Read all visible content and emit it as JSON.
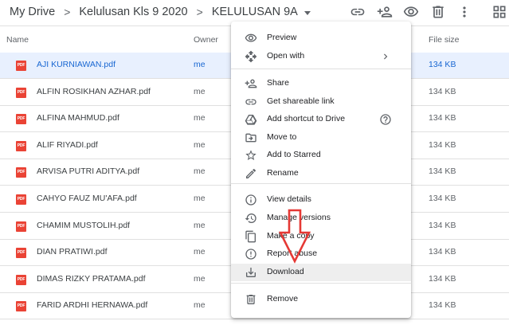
{
  "breadcrumb": {
    "items": [
      "My Drive",
      "Kelulusan Kls 9 2020",
      "KELULUSAN 9A"
    ],
    "separator": ">"
  },
  "toolbar": {
    "icons": [
      "link-icon",
      "add-person-icon",
      "eye-icon",
      "trash-icon",
      "more-vert-icon",
      "grid-view-icon"
    ]
  },
  "columns": {
    "name": "Name",
    "owner": "Owner",
    "file_size": "File size"
  },
  "files": [
    {
      "name": "AJI KURNIAWAN.pdf",
      "owner": "me",
      "size": "134 KB",
      "selected": true
    },
    {
      "name": "ALFIN ROSIKHAN AZHAR.pdf",
      "owner": "me",
      "size": "134 KB",
      "selected": false
    },
    {
      "name": "ALFINA MAHMUD.pdf",
      "owner": "me",
      "size": "134 KB",
      "selected": false
    },
    {
      "name": "ALIF RIYADI.pdf",
      "owner": "me",
      "size": "134 KB",
      "selected": false
    },
    {
      "name": "ARVISA PUTRI ADITYA.pdf",
      "owner": "me",
      "size": "134 KB",
      "selected": false
    },
    {
      "name": "CAHYO FAUZ MU'AFA.pdf",
      "owner": "me",
      "size": "134 KB",
      "selected": false
    },
    {
      "name": "CHAMIM MUSTOLIH.pdf",
      "owner": "me",
      "size": "134 KB",
      "selected": false
    },
    {
      "name": "DIAN PRATIWI.pdf",
      "owner": "me",
      "size": "134 KB",
      "selected": false
    },
    {
      "name": "DIMAS RIZKY PRATAMA.pdf",
      "owner": "me",
      "size": "134 KB",
      "selected": false
    },
    {
      "name": "FARID ARDHI HERNAWA.pdf",
      "owner": "me",
      "size": "134 KB",
      "selected": false
    }
  ],
  "file_icon_label": "PDF",
  "context_menu": {
    "items": [
      {
        "label": "Preview",
        "icon": "eye-icon"
      },
      {
        "label": "Open with",
        "icon": "move-arrows-icon",
        "submenu": true
      },
      {
        "label": "Share",
        "icon": "add-person-icon"
      },
      {
        "label": "Get shareable link",
        "icon": "link-icon"
      },
      {
        "label": "Add shortcut to Drive",
        "icon": "drive-shortcut-icon",
        "help": true
      },
      {
        "label": "Move to",
        "icon": "move-to-folder-icon"
      },
      {
        "label": "Add to Starred",
        "icon": "star-icon"
      },
      {
        "label": "Rename",
        "icon": "pencil-icon"
      },
      {
        "label": "View details",
        "icon": "info-icon"
      },
      {
        "label": "Manage versions",
        "icon": "history-icon"
      },
      {
        "label": "Make a copy",
        "icon": "copy-icon"
      },
      {
        "label": "Report abuse",
        "icon": "report-icon"
      },
      {
        "label": "Download",
        "icon": "download-icon",
        "highlighted": true
      },
      {
        "label": "Remove",
        "icon": "trash-icon"
      }
    ]
  },
  "colors": {
    "selected_row_bg": "#e8f0fe",
    "selected_text": "#1967d2",
    "pdf_red": "#ea4335",
    "annotation_red": "#e53935",
    "menu_hover": "#eeeeee"
  }
}
